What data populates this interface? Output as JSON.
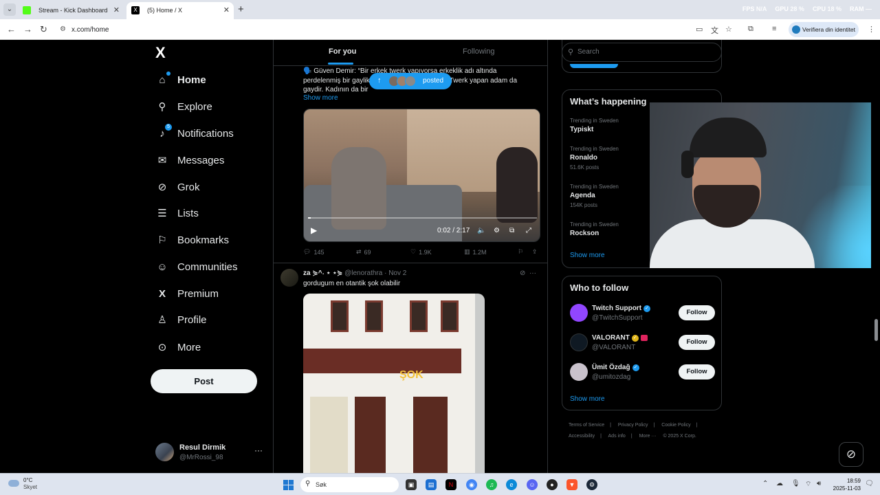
{
  "browser": {
    "tabs": [
      {
        "title": "Stream - Kick Dashboard",
        "active": false,
        "favicon_color": "#53fc18"
      },
      {
        "title": "(5) Home / X",
        "active": true,
        "favicon_color": "#000000"
      }
    ],
    "new_tab_symbol": "+",
    "address": "x.com/home",
    "profile_chip": "Verifiera din identitet",
    "system_monitor": [
      {
        "label": "FPS",
        "value": "N/A"
      },
      {
        "label": "GPU",
        "value": "28 %"
      },
      {
        "label": "CPU",
        "value": "18 %"
      },
      {
        "label": "RAM",
        "value": "—"
      }
    ]
  },
  "sidebar": {
    "logo": "X",
    "items": [
      {
        "label": "Home",
        "icon": "home-icon",
        "glyph": "⌂",
        "bold": true
      },
      {
        "label": "Explore",
        "icon": "search-icon",
        "glyph": "⚲"
      },
      {
        "label": "Notifications",
        "icon": "bell-icon",
        "glyph": "🔔",
        "badge": "5"
      },
      {
        "label": "Messages",
        "icon": "mail-icon",
        "glyph": "✉"
      },
      {
        "label": "Grok",
        "icon": "grok-icon",
        "glyph": "⊘"
      },
      {
        "label": "Lists",
        "icon": "list-icon",
        "glyph": "☰"
      },
      {
        "label": "Bookmarks",
        "icon": "bookmark-icon",
        "glyph": "⚐"
      },
      {
        "label": "Communities",
        "icon": "communities-icon",
        "glyph": "👥"
      },
      {
        "label": "Premium",
        "icon": "x-premium-icon",
        "glyph": "X"
      },
      {
        "label": "Profile",
        "icon": "person-icon",
        "glyph": "👤"
      },
      {
        "label": "More",
        "icon": "more-circle-icon",
        "glyph": "⋯"
      }
    ],
    "post_button": "Post",
    "user": {
      "name": "Resul Dirmik",
      "handle": "@MrRossi_98",
      "more": "···"
    }
  },
  "timeline": {
    "tabs": [
      {
        "label": "For you",
        "active": true
      },
      {
        "label": "Following",
        "active": false
      }
    ],
    "posted_pill": "posted",
    "tweet1": {
      "text_line1": "🗣️ Güven Demir: “Bir erkek twerk yapıyorsa erkeklik adı altında",
      "text_line2": "perdelenmiş bir gaylik                                  nez. Twerk yapan adam da",
      "text_line3": "gaydir. Kadının da bir",
      "show_more": "Show more",
      "video_time": "0:02 / 2:17",
      "replies": "145",
      "reposts": "69",
      "likes": "1.9K",
      "views": "1.2M"
    },
    "tweet2": {
      "name": "za ⋟^˖ ⋆ ⋆⋟",
      "handle": "@lenorathra",
      "date": "Nov 2",
      "text": "gordugum en otantik şok olabilir",
      "sign": "ŞOK"
    }
  },
  "right": {
    "search_placeholder": "Search",
    "whats_happening": {
      "title": "What’s happening",
      "trends": [
        {
          "category": "Trending in Sweden",
          "name": "Typiskt",
          "count": ""
        },
        {
          "category": "Trending in Sweden",
          "name": "Ronaldo",
          "count": "51.6K posts"
        },
        {
          "category": "Trending in Sweden",
          "name": "Agenda",
          "count": "154K posts"
        },
        {
          "category": "Trending in Sweden",
          "name": "Rockson",
          "count": ""
        }
      ],
      "show_more": "Show more"
    },
    "who_to_follow": {
      "title": "Who to follow",
      "accounts": [
        {
          "name": "Twitch Support",
          "handle": "@TwitchSupport",
          "button": "Follow",
          "avatar_color": "#9146ff",
          "verified": "blue"
        },
        {
          "name": "VALORANT",
          "handle": "@VALORANT",
          "button": "Follow",
          "avatar_color": "#0f1923",
          "verified": "gold"
        },
        {
          "name": "Ümit Özdağ",
          "handle": "@umitozdag",
          "button": "Follow",
          "avatar_color": "#c9c2cc",
          "verified": "blue"
        }
      ],
      "show_more": "Show more"
    },
    "footer": {
      "links": [
        "Terms of Service",
        "|",
        "Privacy Policy",
        "|",
        "Cookie Policy",
        "|",
        "Accessibility",
        "|",
        "Ads info",
        "|",
        "More ···",
        "© 2025 X Corp."
      ]
    }
  },
  "taskbar": {
    "weather_temp": "0°C",
    "weather_desc": "Skyet",
    "search_placeholder": "Søk",
    "time": "18:59",
    "date": "2025-11-03"
  }
}
